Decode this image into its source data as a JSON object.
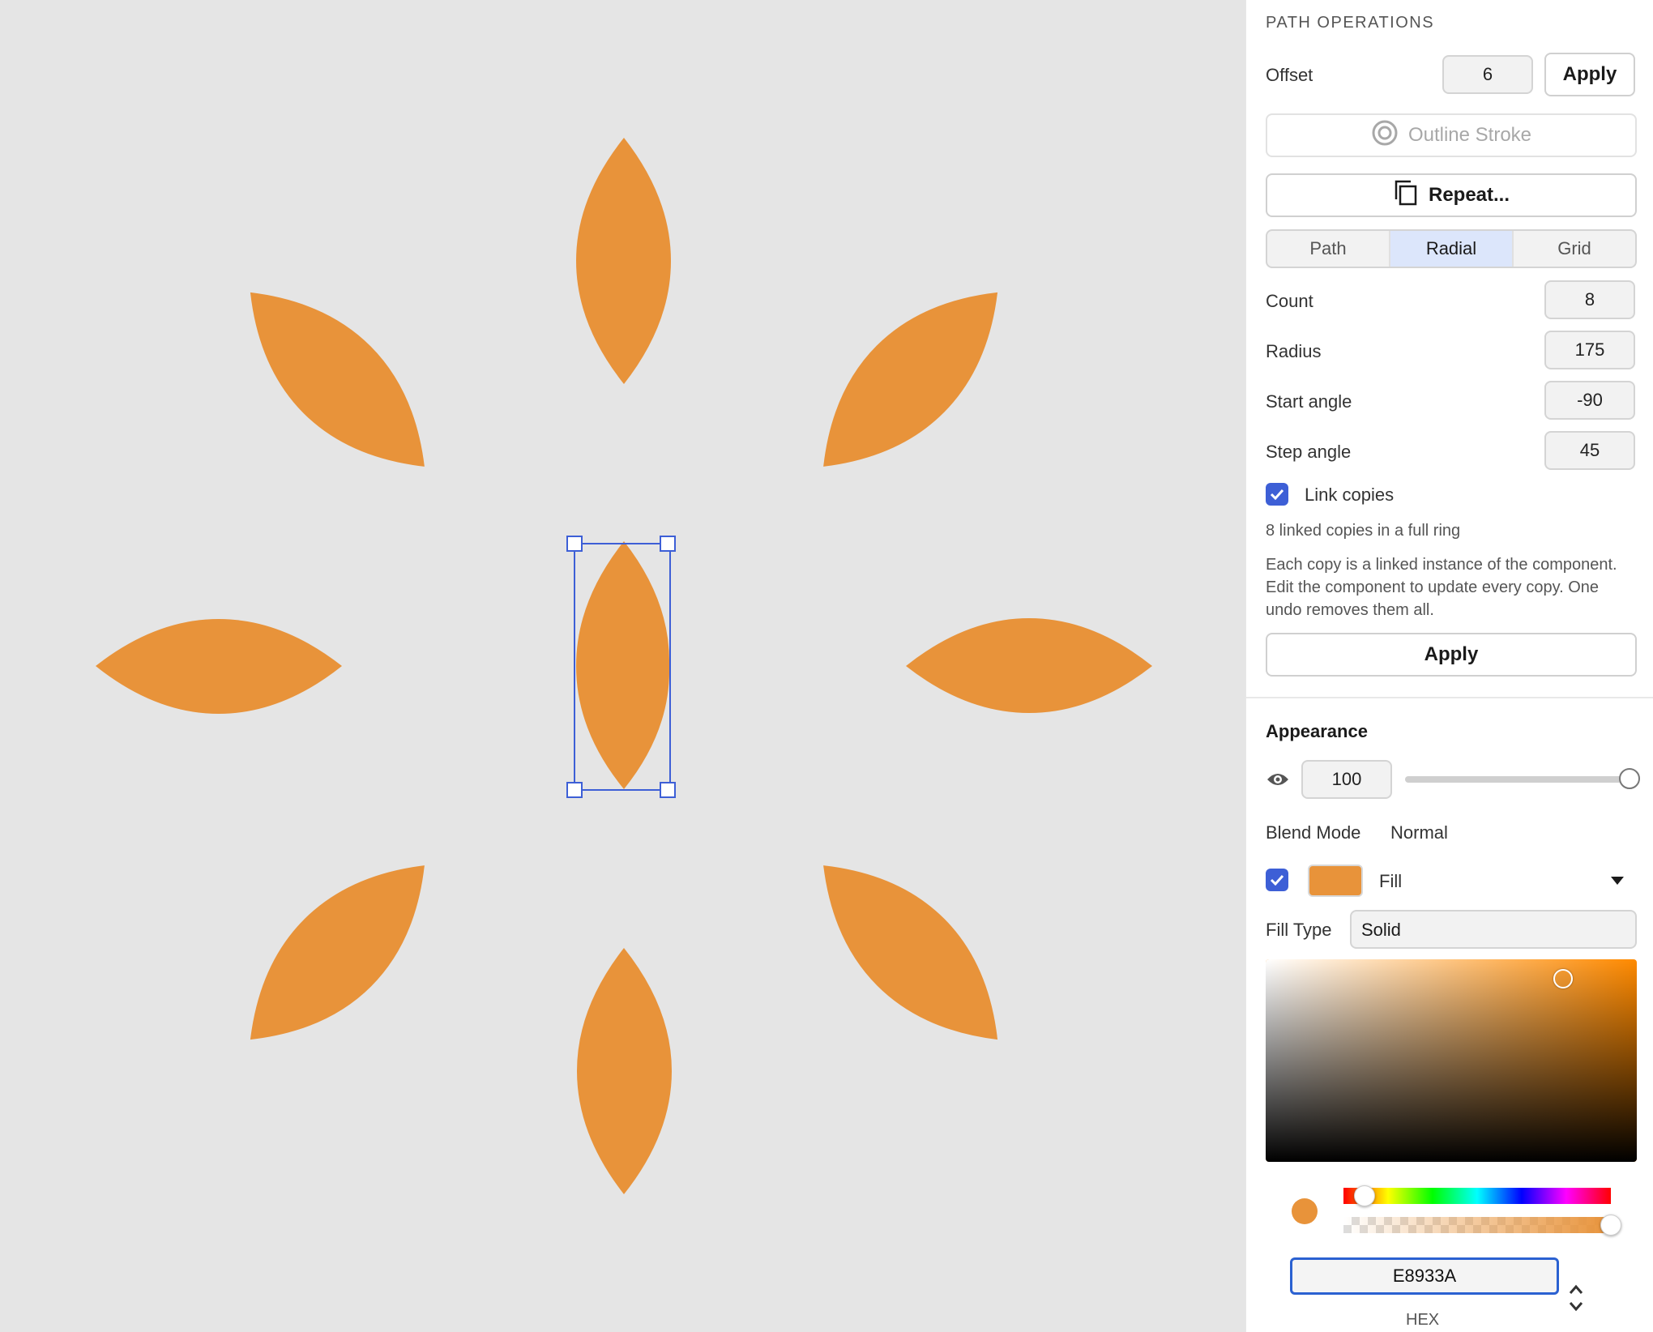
{
  "panel": {
    "section_title": "PATH OPERATIONS",
    "offset": {
      "label": "Offset",
      "value": "6",
      "apply_label": "Apply"
    },
    "outline_stroke": {
      "label": "Outline Stroke",
      "icon": "outline-stroke-icon"
    },
    "repeat": {
      "label": "Repeat...",
      "icon": "copy-icon"
    },
    "tabs": [
      {
        "label": "Path",
        "active": false
      },
      {
        "label": "Radial",
        "active": true
      },
      {
        "label": "Grid",
        "active": false
      }
    ],
    "fields": {
      "count": {
        "label": "Count",
        "value": "8"
      },
      "radius": {
        "label": "Radius",
        "value": "175"
      },
      "start_angle": {
        "label": "Start angle",
        "value": "-90"
      },
      "step_angle": {
        "label": "Step angle",
        "value": "45"
      }
    },
    "link_copies": {
      "label": "Link copies",
      "checked": true
    },
    "summary": "8 linked copies in a full ring",
    "description": "Each copy is a linked instance of the component. Edit the component to update every copy. One undo removes them all.",
    "apply_label": "Apply"
  },
  "appearance": {
    "title": "Appearance",
    "opacity_value": "100",
    "opacity_level": 1.0,
    "blend_mode": {
      "label": "Blend Mode",
      "value": "Normal"
    },
    "fill": {
      "label": "Fill",
      "enabled": true,
      "color": "#E8933A"
    },
    "fill_type": {
      "label": "Fill Type",
      "value": "Solid"
    },
    "picker": {
      "hue_color": "#FF8A00",
      "hue_level": 0.08,
      "alpha_level": 1.0,
      "hex_value": "E8933A",
      "hex_label": "HEX"
    }
  },
  "canvas": {
    "background": "#E5E5E5",
    "petal_color": "#E8933A",
    "selection_color": "#3D5FD6",
    "copy_count": 8
  }
}
